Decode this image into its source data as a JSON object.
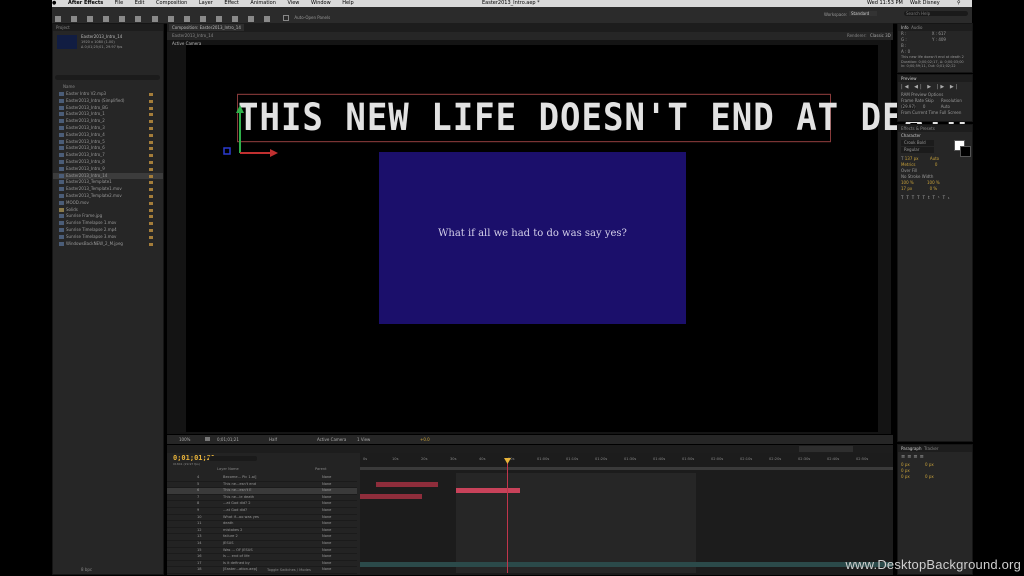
{
  "menu": {
    "app": "After Effects",
    "items": [
      "File",
      "Edit",
      "Composition",
      "Layer",
      "Effect",
      "Animation",
      "View",
      "Window",
      "Help"
    ],
    "window_title": "Easter2013_Intro.aep *",
    "clock": "Wed 11:53 PM",
    "user": "Walt Disney"
  },
  "toolbar": {
    "auto_open": "Auto-Open Panels",
    "workspace_label": "Workspace:",
    "workspace_value": "Standard",
    "search_placeholder": "Search Help"
  },
  "project": {
    "tab": "Project",
    "selected_name": "Easter2013_Intro_14",
    "selected_info": "1920 x 1080 (1.00)",
    "selected_duration": "Δ 0;01;25;01, 29.97 fps",
    "column_name": "Name",
    "items": [
      "Easter Intro V2.mp3",
      "Easter2013_Intro (Simplified)",
      "Easter2013_Intro_BG",
      "Easter2013_Intro_1",
      "Easter2013_Intro_2",
      "Easter2013_Intro_3",
      "Easter2013_Intro_4",
      "Easter2013_Intro_5",
      "Easter2013_Intro_6",
      "Easter2013_Intro_7",
      "Easter2013_Intro_8",
      "Easter2013_Intro_9",
      "Easter2013_Intro_14",
      "Easter2013_Template1",
      "Easter2013_Template1.mov",
      "Easter2013_Template2.mov",
      "MOOD.mov",
      "Solids",
      "Sunrise Frame.jpg",
      "Sunrise Timelapse 1.mov",
      "Sunrise Timelapse 2.mp4",
      "Sunrise Timelapse 3.mov",
      "WindowsBackNEW_2_M.jpeg"
    ],
    "bpc": "8 bpc"
  },
  "composition": {
    "tab": "Composition: Easter2013_Intro_14",
    "subtab": "Easter2013_Intro_14",
    "active_camera": "Active Camera",
    "renderer": "Renderer:",
    "renderer_value": "Classic 3D",
    "title_text": "THIS NEW LIFE DOESN'T END AT DEATH",
    "body_text": "What if all we had to do was say yes?",
    "zoom": "100%",
    "timecode": "0;01;01;21",
    "resolution": "Half",
    "view": "Active Camera",
    "views": "1 View",
    "exposure": "+0.0"
  },
  "timeline": {
    "timecode": "0;01;01;21",
    "frame_info": "01841 (29.97 fps)",
    "columns": {
      "layer_name": "Layer Name",
      "parent": "Parent"
    },
    "toggle_label": "Toggle Switches / Modes",
    "layers": [
      {
        "num": "4",
        "name": "Become... Pic 1.ai]",
        "parent": "None"
      },
      {
        "num": "5",
        "name": "This ne...esn't end",
        "parent": "None"
      },
      {
        "num": "6",
        "name": "This ne...esn't E",
        "parent": "None"
      },
      {
        "num": "7",
        "name": "This ne...ie death",
        "parent": "None"
      },
      {
        "num": "8",
        "name": "...at God did? 2",
        "parent": "None"
      },
      {
        "num": "9",
        "name": "...at God did?",
        "parent": "None"
      },
      {
        "num": "10",
        "name": "What if...oo was yes",
        "parent": "None"
      },
      {
        "num": "11",
        "name": "death",
        "parent": "None"
      },
      {
        "num": "12",
        "name": "mistakes 2",
        "parent": "None"
      },
      {
        "num": "13",
        "name": "failure 2",
        "parent": "None"
      },
      {
        "num": "14",
        "name": "JESUS",
        "parent": "None"
      },
      {
        "num": "15",
        "name": "Was ... OF JESUS",
        "parent": "None"
      },
      {
        "num": "16",
        "name": "Is ... end of life",
        "parent": "None"
      },
      {
        "num": "17",
        "name": "Is it defined by",
        "parent": "None"
      },
      {
        "num": "18",
        "name": "[Easter...ation.aep]",
        "parent": "None"
      }
    ],
    "ruler_ticks": [
      "0s",
      "10s",
      "20s",
      "30s",
      "40s",
      "50s",
      "01:00s",
      "01:10s",
      "01:20s",
      "01:30s",
      "01:40s",
      "01:50s",
      "02:00s",
      "02:10s",
      "02:20s",
      "02:30s",
      "02:40s",
      "02:50s"
    ]
  },
  "info_panel": {
    "tab": "Info",
    "audio_tab": "Audio",
    "r": "R :",
    "g": "G :",
    "b": "B :",
    "a": "A : 0",
    "x": "X : 617",
    "y": "Y : 409",
    "desc_line1": "This new life doesn't end at death 2",
    "desc_line2": "Duration: 0;00;02;17, Δ: 0;00;03;00",
    "desc_line3": "In: 0;00;59;11, Out: 0;01;02;22"
  },
  "preview_panel": {
    "tab": "Preview",
    "ram_preview": "RAM Preview Options",
    "frame_rate": "Frame Rate",
    "skip": "Skip",
    "resolution": "Resolution",
    "fps_value": "(29.97)",
    "skip_value": "0",
    "res_value": "Auto",
    "from_current": "From Current Time",
    "full_screen": "Full Screen"
  },
  "character_panel": {
    "tab": "Character",
    "tab2": "Effects & Presets",
    "font": "Crook Bold",
    "style": "Regular",
    "size": "137 px",
    "leading": "Auto",
    "tracking": "0",
    "metrics": "Metrics",
    "stroke": "Over Fill",
    "stroke_width": "No Stroke Width",
    "vert_scale": "100 %",
    "horiz_scale": "100 %",
    "baseline": "17 px",
    "tsume": "0 %"
  },
  "paragraph_panel": {
    "tab": "Paragraph",
    "tab2": "Tracker",
    "indent1": "0 px",
    "indent2": "0 px",
    "indent3": "0 px",
    "space1": "0 px",
    "space2": "0 px"
  },
  "watermark": "www.DesktopBackground.org",
  "colors": {
    "title_stroke": "#883a3a",
    "blue_box": "#1b0f6b",
    "timecode": "#e8b33a",
    "bar_red": "#8e2d3b",
    "bar_pink": "#c8425a",
    "label_yellow": "#a47d3a"
  }
}
